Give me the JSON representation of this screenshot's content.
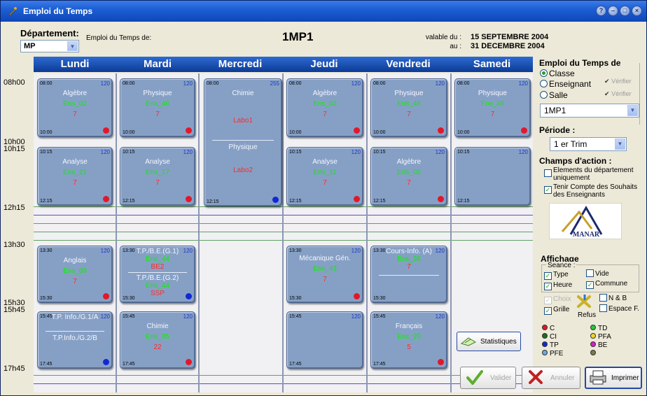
{
  "window": {
    "title": "Emploi du Temps"
  },
  "header": {
    "departement_label": "Département:",
    "departement_value": "MP",
    "emploi_de_label": "Emploi du Temps de:",
    "class_code": "1MP1",
    "valable_du_label": "valable du :",
    "valable_au_label": "au :",
    "valable_du": "15 SEPTEMBRE 2004",
    "valable_au": "31 DECEMBRE 2004"
  },
  "days": [
    "Lundi",
    "Mardi",
    "Mercredi",
    "Jeudi",
    "Vendredi",
    "Samedi"
  ],
  "hours": [
    "08h00",
    "10h00",
    "10h15",
    "12h15",
    "13h30",
    "15h30",
    "15h45",
    "17h45"
  ],
  "cards": [
    {
      "start": "08:00",
      "end": "10:00",
      "num": "120",
      "subject": "Algèbre",
      "ens": "Ens_02",
      "count": "7"
    },
    {
      "start": "08:00",
      "end": "10:00",
      "num": "120",
      "subject": "Physique",
      "ens": "Ens_46",
      "count": "7"
    },
    {
      "start": "08:00",
      "end": "12:15",
      "num": "255",
      "subject": "Chimie",
      "room1": "Labo1",
      "subject2": "Physique",
      "room2": "Labo2"
    },
    {
      "start": "08:00",
      "end": "10:00",
      "num": "120",
      "subject": "Algèbre",
      "ens": "Ens_02",
      "count": "7"
    },
    {
      "start": "08:00",
      "end": "10:00",
      "num": "120",
      "subject": "Physique",
      "ens": "Ens_46",
      "count": "7"
    },
    {
      "start": "08:00",
      "end": "10:00",
      "num": "120",
      "subject": "Physique",
      "ens": "Ens_46",
      "count": "7"
    },
    {
      "start": "10:15",
      "end": "12:15",
      "num": "120",
      "subject": "Analyse",
      "ens": "Ens_21",
      "count": "7"
    },
    {
      "start": "10:15",
      "end": "12:15",
      "num": "120",
      "subject": "Analyse",
      "ens": "Ens_17",
      "count": "7"
    },
    {
      "start": "10:15",
      "end": "12:15",
      "num": "120",
      "subject": "Analyse",
      "ens": "Ens_11",
      "count": "7"
    },
    {
      "start": "10:15",
      "end": "12:15",
      "num": "120",
      "subject": "Algèbre",
      "ens": "Ens_02",
      "count": "7"
    },
    {
      "start": "10:15",
      "end": "12:15",
      "num": "120"
    },
    {
      "start": "13:30",
      "end": "15:30",
      "num": "120",
      "subject": "Anglais",
      "ens": "Ens_09",
      "count": "7"
    },
    {
      "start": "13:30",
      "end": "15:30",
      "num": "120",
      "subject": "T.P./B.E.(G.1)",
      "ens": "Ens_44",
      "room1": "BE2",
      "subject2": "T.P./B.E.(G.2)",
      "ens2": "Ens_44",
      "room2": "SSP"
    },
    {
      "start": "13:30",
      "end": "15:30",
      "num": "120",
      "subject": "Mécanique Gén.",
      "ens": "Ens_43",
      "count": "7"
    },
    {
      "start": "13:30",
      "end": "15:30",
      "num": "120",
      "subject": "Cours-Info. (A)",
      "ens": "Ens_36",
      "count": "7"
    },
    {
      "start": "15:45",
      "end": "17:45",
      "num": "120",
      "subject": "T.P. Info./G.1/A",
      "subject2": "T.P.Info./G.2/B"
    },
    {
      "start": "15:45",
      "end": "17:45",
      "num": "120",
      "subject": "Chimie",
      "ens": "Ens_05",
      "count": "22"
    },
    {
      "start": "15:45",
      "end": "17:45",
      "num": "120"
    },
    {
      "start": "15:45",
      "end": "17:45",
      "num": "120",
      "subject": "Français",
      "ens": "Ens_20",
      "count": "5"
    }
  ],
  "right_panel": {
    "emploi_title": "Emploi du Temps de",
    "radio_classe": "Classe",
    "radio_enseignant": "Enseignant",
    "radio_salle": "Salle",
    "verifier": "Vérifier",
    "class_select": "1MP1",
    "periode_title": "Période :",
    "periode_value": "1 er Trim",
    "champs_title": "Champs d'action :",
    "chk_elements": "Elements du département uniquement",
    "chk_tenir": "Tenir Compte des Souhaits des Enseignants",
    "logo_text": "MANAR",
    "affichage_title": "Affichage",
    "seance_label": "Seance :",
    "chk_type": "Type",
    "chk_vide": "Vide",
    "chk_heure": "Heure",
    "chk_commune": "Commune",
    "chk_choix": "Choix",
    "chk_nb": "N & B",
    "chk_grille": "Grille",
    "chk_espace": "Espace F.",
    "refus": "Refus",
    "legend": [
      {
        "label": "C",
        "color": "#e3172a"
      },
      {
        "label": "TD",
        "color": "#22c93a"
      },
      {
        "label": "CI",
        "color": "#1d6b21"
      },
      {
        "label": "PFA",
        "color": "#f3d625"
      },
      {
        "label": "TP",
        "color": "#1028d6"
      },
      {
        "label": "BE",
        "color": "#d91cc9"
      },
      {
        "label": "PFE",
        "color": "#6fa9d8"
      },
      {
        "label": "",
        "color": "#7c7a4e"
      }
    ]
  },
  "buttons": {
    "statistiques": "Statistiques",
    "valider": "Valider",
    "annuler": "Annuler",
    "imprimer": "Imprimer"
  }
}
